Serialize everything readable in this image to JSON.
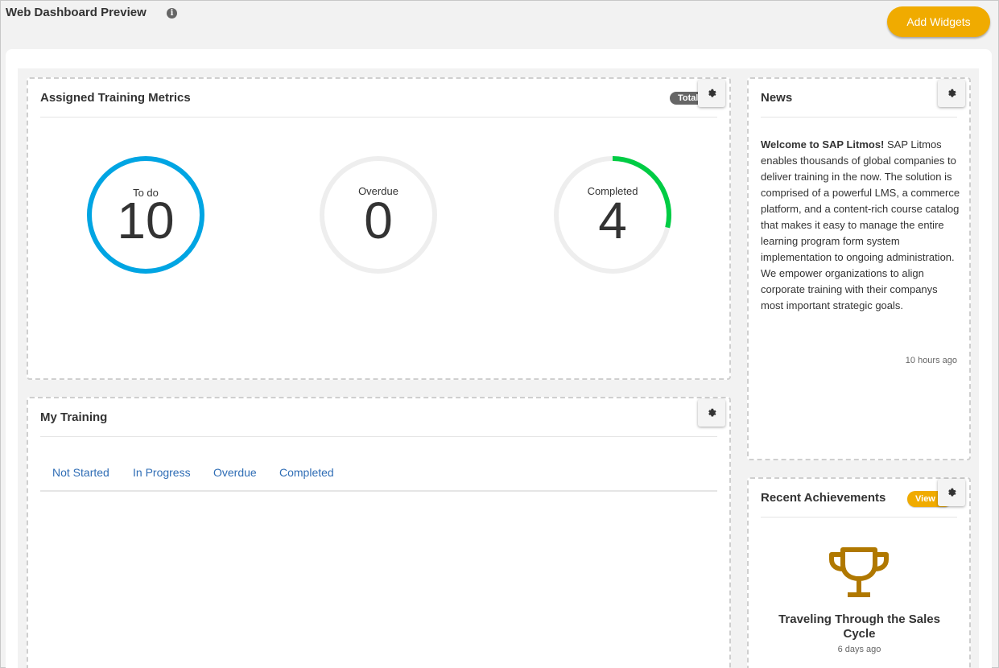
{
  "header": {
    "title": "Web Dashboard Preview",
    "info_icon": "i",
    "add_widgets_label": "Add Widgets"
  },
  "colors": {
    "accent": "#f0ab00",
    "todo_ring": "#00a5e3",
    "completed_ring": "#00cc44",
    "ring_track": "#eeeeee",
    "link": "#2f6db5"
  },
  "metrics_widget": {
    "title": "Assigned Training Metrics",
    "badge": "Total",
    "items": [
      {
        "label": "To do",
        "value": "10",
        "progress": 1.0,
        "color": "#00a5e3"
      },
      {
        "label": "Overdue",
        "value": "0",
        "progress": 0.0,
        "color": "#00cc44"
      },
      {
        "label": "Completed",
        "value": "4",
        "progress": 0.286,
        "color": "#00cc44"
      }
    ]
  },
  "training_widget": {
    "title": "My Training",
    "tabs": [
      "Not Started",
      "In Progress",
      "Overdue",
      "Completed"
    ]
  },
  "news_widget": {
    "title": "News",
    "lead": "Welcome to SAP Litmos!",
    "body": " SAP Litmos enables thousands of global companies to deliver training in the now. The solution is comprised of a powerful LMS, a commerce platform, and a content-rich course catalog that makes it easy to manage the entire learning program form system implementation to ongoing administration. We empower organizations to align corporate training with their companys most important strategic goals.",
    "time": "10 hours ago"
  },
  "achievements_widget": {
    "title": "Recent Achievements",
    "view_label": "View",
    "achievement_title": "Traveling Through the Sales Cycle",
    "time": "6 days ago",
    "icon": "trophy-icon"
  }
}
